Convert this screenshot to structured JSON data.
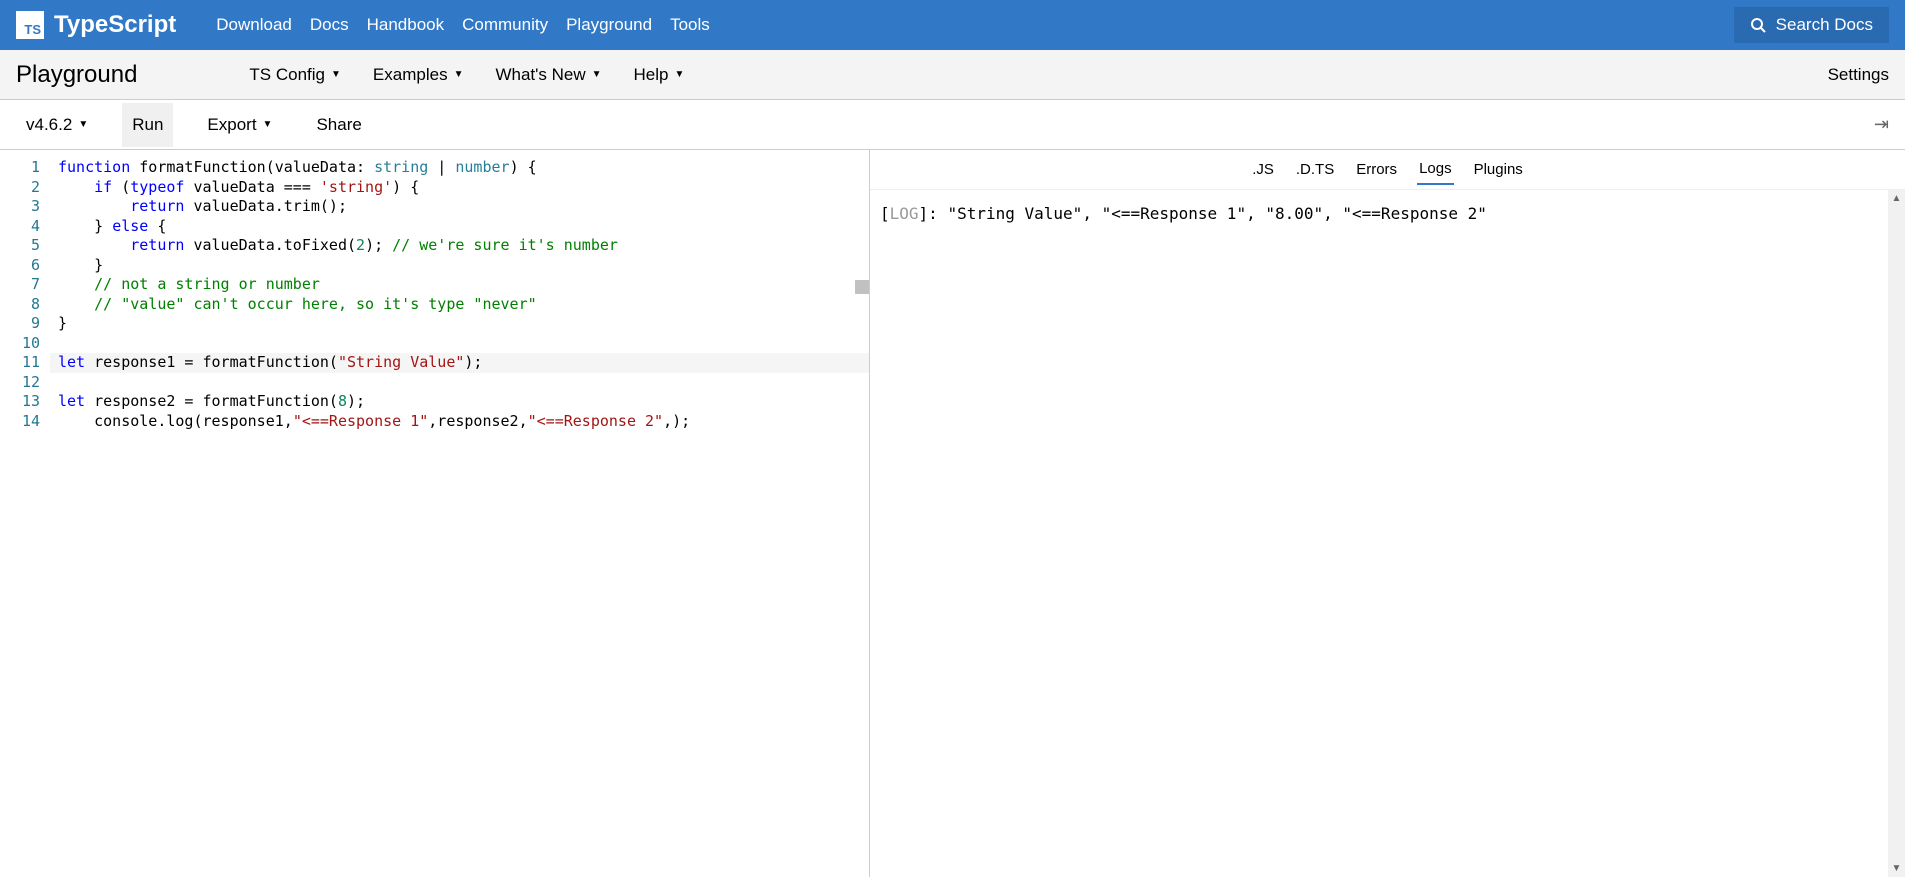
{
  "header": {
    "brand": "TypeScript",
    "logo_badge": "TS",
    "nav": [
      "Download",
      "Docs",
      "Handbook",
      "Community",
      "Playground",
      "Tools"
    ],
    "search_placeholder": "Search Docs"
  },
  "subbar": {
    "title": "Playground",
    "items": [
      "TS Config",
      "Examples",
      "What's New",
      "Help"
    ],
    "settings": "Settings"
  },
  "toolbar": {
    "version": "v4.6.2",
    "run": "Run",
    "export": "Export",
    "share": "Share"
  },
  "editor": {
    "line_count": 14,
    "highlight_line": 11,
    "lines": [
      [
        [
          "kw",
          "function"
        ],
        [
          "op",
          " formatFunction(valueData: "
        ],
        [
          "type",
          "string"
        ],
        [
          "op",
          " | "
        ],
        [
          "type",
          "number"
        ],
        [
          "op",
          ") {"
        ]
      ],
      [
        [
          "op",
          "    "
        ],
        [
          "kw",
          "if"
        ],
        [
          "op",
          " ("
        ],
        [
          "kw",
          "typeof"
        ],
        [
          "op",
          " valueData === "
        ],
        [
          "str",
          "'string'"
        ],
        [
          "op",
          ") {"
        ]
      ],
      [
        [
          "op",
          "        "
        ],
        [
          "kw",
          "return"
        ],
        [
          "op",
          " valueData.trim();"
        ]
      ],
      [
        [
          "op",
          "    } "
        ],
        [
          "kw",
          "else"
        ],
        [
          "op",
          " {"
        ]
      ],
      [
        [
          "op",
          "        "
        ],
        [
          "kw",
          "return"
        ],
        [
          "op",
          " valueData.toFixed("
        ],
        [
          "num",
          "2"
        ],
        [
          "op",
          "); "
        ],
        [
          "cmt",
          "// we're sure it's number"
        ]
      ],
      [
        [
          "op",
          "    }"
        ]
      ],
      [
        [
          "op",
          "    "
        ],
        [
          "cmt",
          "// not a string or number"
        ]
      ],
      [
        [
          "op",
          "    "
        ],
        [
          "cmt",
          "// \"value\" can't occur here, so it's type \"never\""
        ]
      ],
      [
        [
          "op",
          "}"
        ]
      ],
      [],
      [
        [
          "kw",
          "let"
        ],
        [
          "op",
          " response1 = formatFunction("
        ],
        [
          "str",
          "\"String Value\""
        ],
        [
          "op",
          ");"
        ]
      ],
      [],
      [
        [
          "kw",
          "let"
        ],
        [
          "op",
          " response2 = formatFunction("
        ],
        [
          "num",
          "8"
        ],
        [
          "op",
          ");"
        ]
      ],
      [
        [
          "op",
          "    console.log(response1,"
        ],
        [
          "str",
          "\"<==Response 1\""
        ],
        [
          "op",
          ",response2,"
        ],
        [
          "str",
          "\"<==Response 2\""
        ],
        [
          "op",
          ",);"
        ]
      ]
    ]
  },
  "tabs": {
    "items": [
      ".JS",
      ".D.TS",
      "Errors",
      "Logs",
      "Plugins"
    ],
    "active": "Logs"
  },
  "output": {
    "log_tag": "LOG",
    "text": "\"String Value\",  \"<==Response 1\",  \"8.00\",  \"<==Response 2\""
  }
}
